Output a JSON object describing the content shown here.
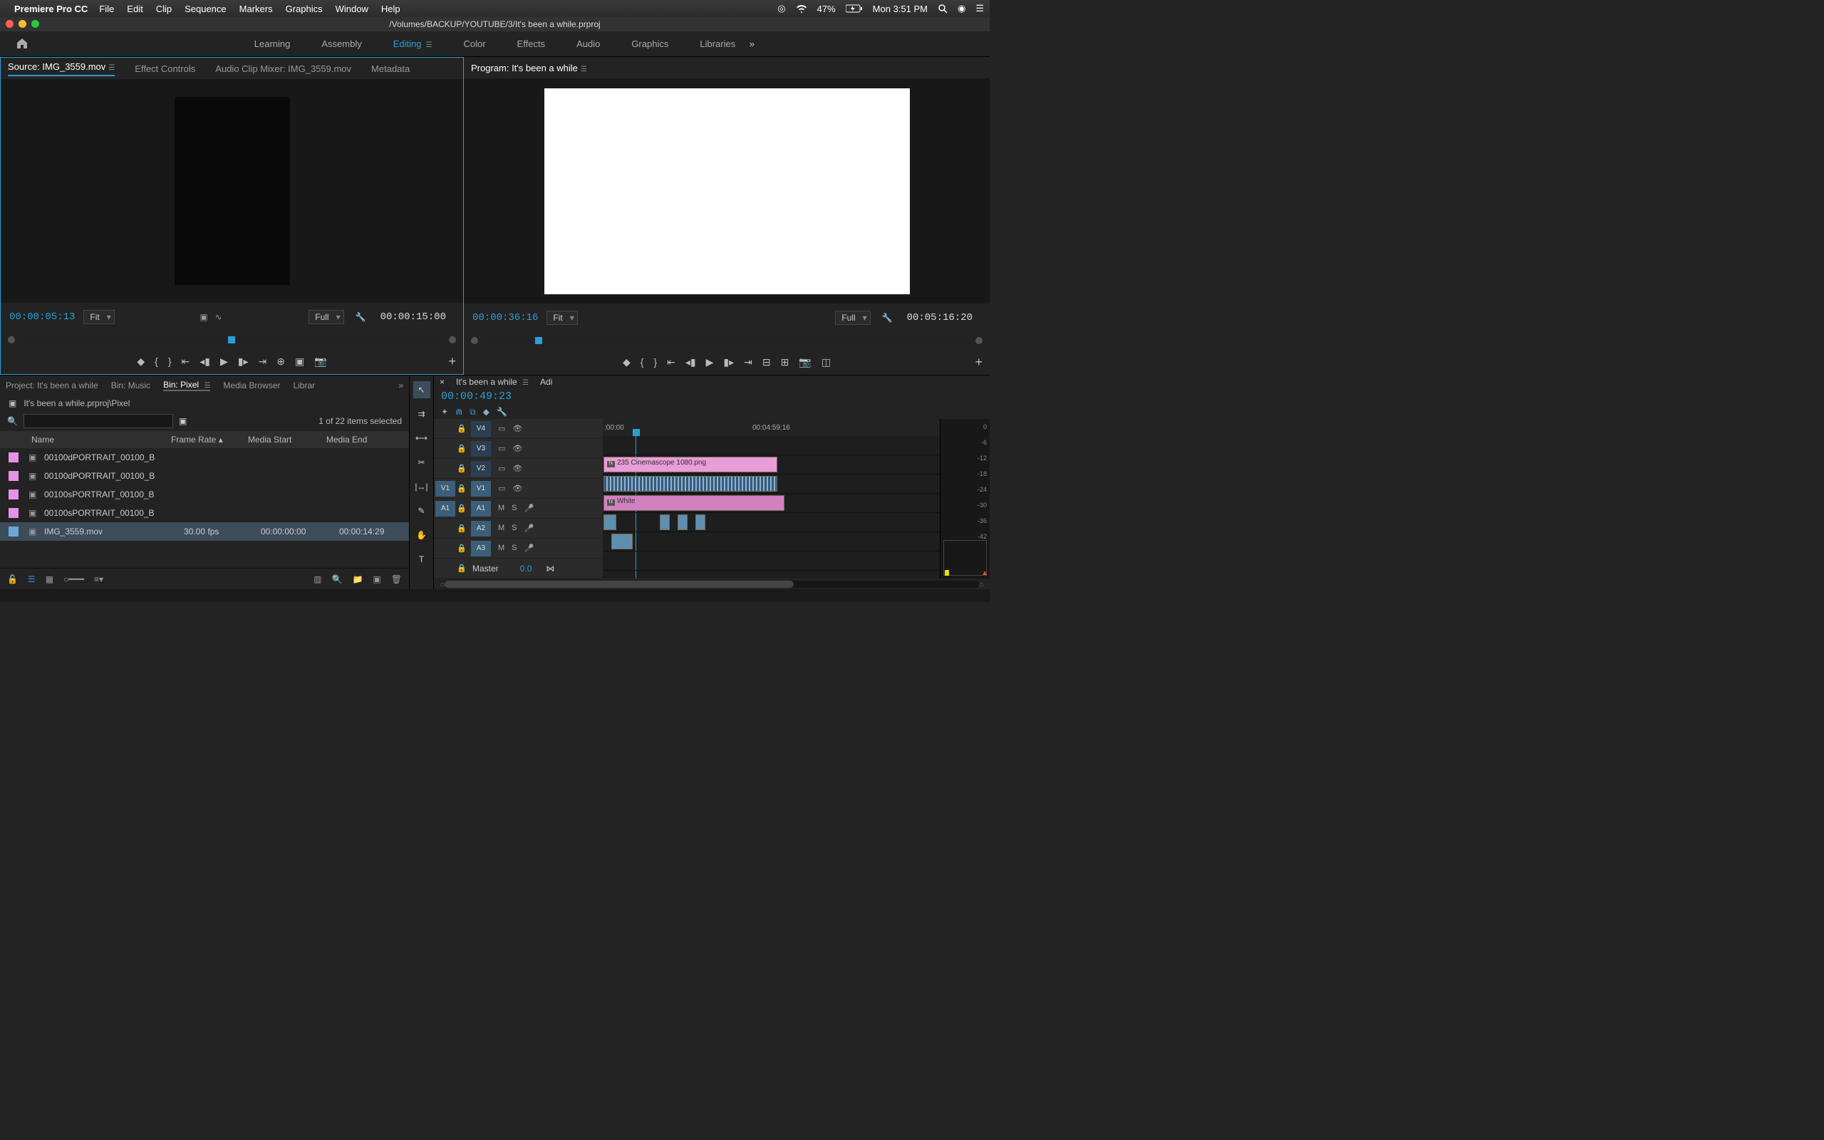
{
  "macmenu": {
    "app": "Premiere Pro CC",
    "items": [
      "File",
      "Edit",
      "Clip",
      "Sequence",
      "Markers",
      "Graphics",
      "Window",
      "Help"
    ],
    "battery": "47%",
    "clock": "Mon 3:51 PM"
  },
  "titlebar": "/Volumes/BACKUP/YOUTUBE/3/It's been a while.prproj",
  "workspaces": [
    "Learning",
    "Assembly",
    "Editing",
    "Color",
    "Effects",
    "Audio",
    "Graphics",
    "Libraries"
  ],
  "source_panel": {
    "tabs": [
      "Source: IMG_3559.mov",
      "Effect Controls",
      "Audio Clip Mixer: IMG_3559.mov",
      "Metadata"
    ],
    "tc_left": "00:00:05:13",
    "zoom": "Fit",
    "res": "Full",
    "tc_right": "00:00:15:00"
  },
  "program_panel": {
    "title": "Program: It's been a while",
    "tc_left": "00:00:36:16",
    "zoom": "Fit",
    "res": "Full",
    "tc_right": "00:05:16:20"
  },
  "project": {
    "tabs": [
      "Project: It's been a while",
      "Bin: Music",
      "Bin: Pixel",
      "Media Browser",
      "Librar"
    ],
    "breadcrumb": "It's been a while.prproj\\Pixel",
    "count": "1 of 22 items selected",
    "columns": {
      "name": "Name",
      "fr": "Frame Rate",
      "ms": "Media Start",
      "me": "Media End"
    },
    "rows": [
      {
        "color": "pink",
        "name": "00100dPORTRAIT_00100_B",
        "fr": "",
        "ms": "",
        "me": ""
      },
      {
        "color": "pink",
        "name": "00100dPORTRAIT_00100_B",
        "fr": "",
        "ms": "",
        "me": ""
      },
      {
        "color": "pink",
        "name": "00100sPORTRAIT_00100_B",
        "fr": "",
        "ms": "",
        "me": ""
      },
      {
        "color": "pink",
        "name": "00100sPORTRAIT_00100_B",
        "fr": "",
        "ms": "",
        "me": ""
      },
      {
        "color": "blue",
        "name": "IMG_3559.mov",
        "fr": "30.00 fps",
        "ms": "00:00:00:00",
        "me": "00:00:14:29"
      }
    ]
  },
  "timeline": {
    "seq_name": "It's been a while",
    "tab2": "Adi",
    "tc": "00:00:49:23",
    "ruler_t0": ":00:00",
    "ruler_t1": "00:04:59:16",
    "master_label": "Master",
    "master_val": "0.0",
    "video_tracks": [
      "V4",
      "V3",
      "V2",
      "V1"
    ],
    "audio_tracks": [
      "A1",
      "A2",
      "A3"
    ],
    "clips": {
      "v3": "235 Cinemascope 1080.png",
      "v1": "White"
    },
    "meter_labels": [
      "0",
      "-6",
      "-12",
      "-18",
      "-24",
      "-30",
      "-36",
      "-42"
    ]
  }
}
